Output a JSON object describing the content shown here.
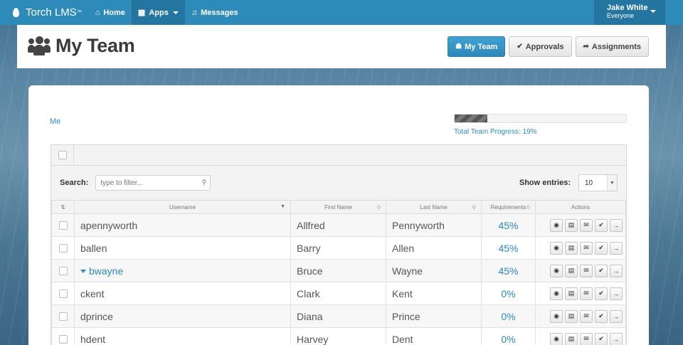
{
  "nav": {
    "brand": "Torch LMS",
    "brand_tm": "™",
    "items": [
      {
        "label": "Home",
        "icon": "home-icon",
        "glyph": "⌂"
      },
      {
        "label": "Apps",
        "icon": "grid-icon",
        "glyph": "▦"
      },
      {
        "label": "Messages",
        "icon": "bell-icon",
        "glyph": "♫"
      }
    ],
    "user": {
      "name": "Jake White",
      "group": "Everyone"
    }
  },
  "header": {
    "title": "My Team",
    "buttons": [
      {
        "label": "My Team",
        "icon": "users-icon",
        "glyph": "☗"
      },
      {
        "label": "Approvals",
        "icon": "check-icon",
        "glyph": "✔"
      },
      {
        "label": "Assignments",
        "icon": "share-icon",
        "glyph": "➦"
      }
    ]
  },
  "team": {
    "me_link": "Me",
    "progress_fraction": 0.19,
    "progress_label": "Total Team Progress: 19%"
  },
  "table": {
    "search_label": "Search:",
    "search_placeholder": "type to filter...",
    "entries_label": "Show entries:",
    "entries_value": "10",
    "columns": [
      "Username",
      "First Name",
      "Last Name",
      "Requirements",
      "Actions"
    ],
    "rows": [
      {
        "username": "apennyworth",
        "first": "Allfred",
        "last": "Pennyworth",
        "req": "45%"
      },
      {
        "username": "ballen",
        "first": "Barry",
        "last": "Allen",
        "req": "45%"
      },
      {
        "username": "bwayne",
        "first": "Bruce",
        "last": "Wayne",
        "req": "45%",
        "expanded": true
      },
      {
        "username": "ckent",
        "first": "Clark",
        "last": "Kent",
        "req": "0%"
      },
      {
        "username": "dprince",
        "first": "Diana",
        "last": "Prince",
        "req": "0%"
      },
      {
        "username": "hdent",
        "first": "Harvey",
        "last": "Dent",
        "req": "0%"
      }
    ],
    "action_icons": [
      {
        "name": "eye-icon",
        "glyph": "◉"
      },
      {
        "name": "clipboard-icon",
        "glyph": "▤"
      },
      {
        "name": "envelope-icon",
        "glyph": "✉"
      },
      {
        "name": "check-icon",
        "glyph": "✔"
      },
      {
        "name": "arrow-right-icon",
        "glyph": "→"
      }
    ]
  }
}
